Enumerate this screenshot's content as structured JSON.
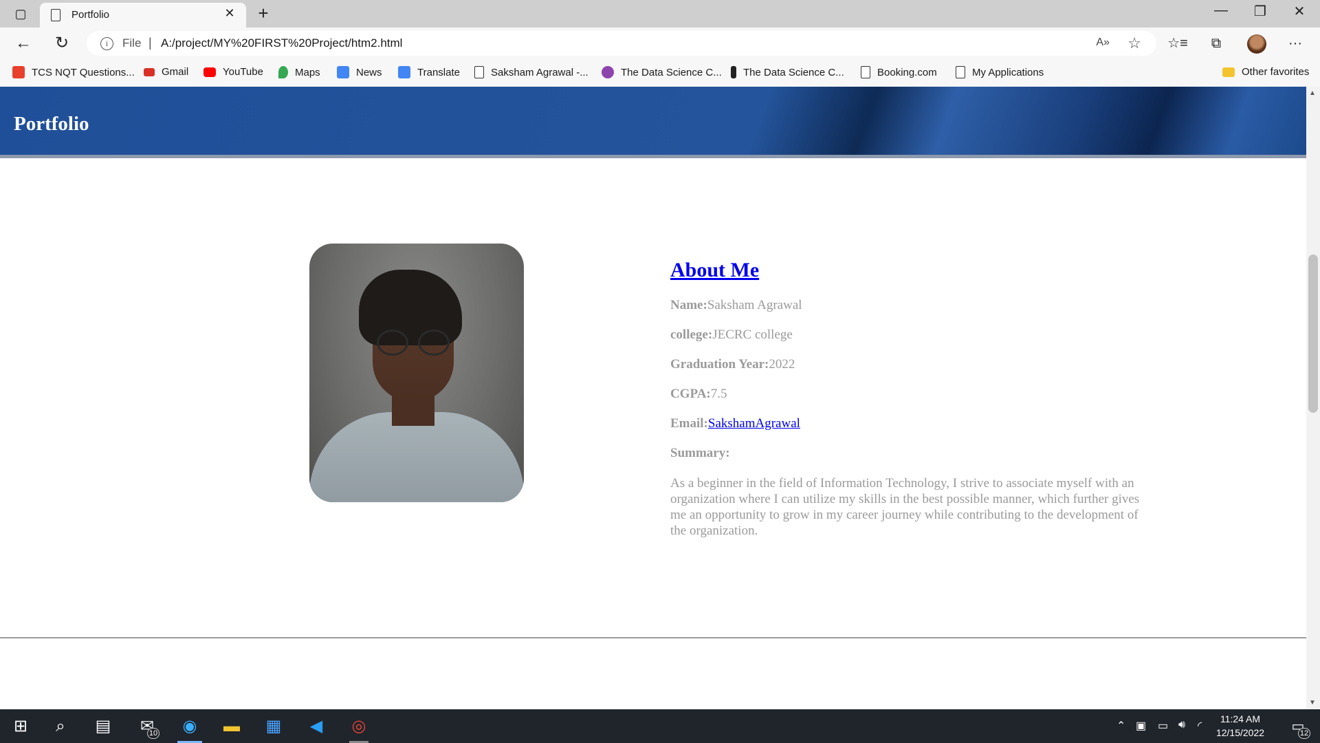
{
  "browser": {
    "tab_title": "Portfolio",
    "tab_close": "✕",
    "new_tab": "+",
    "window_minimize": "—",
    "window_restore": "❐",
    "window_close": "✕",
    "back": "←",
    "reload": "↻",
    "scheme": "File",
    "url": "A:/project/MY%20FIRST%20Project/htm2.html",
    "read_aloud": "A»",
    "add_favorite": "☆",
    "favorites": "☆≡",
    "collections": "⧉",
    "more": "···"
  },
  "bookmarks": [
    {
      "label": "TCS NQT Questions...",
      "icon": "tcs-icon",
      "color": "#e8402b"
    },
    {
      "label": "Gmail",
      "icon": "gmail-icon",
      "color": "#d93025"
    },
    {
      "label": "YouTube",
      "icon": "youtube-icon",
      "color": "#ff0000"
    },
    {
      "label": "Maps",
      "icon": "maps-icon",
      "color": "#34a853"
    },
    {
      "label": "News",
      "icon": "news-icon",
      "color": "#4285f4"
    },
    {
      "label": "Translate",
      "icon": "translate-icon",
      "color": "#4285f4"
    },
    {
      "label": "Saksham Agrawal -...",
      "icon": "page-icon",
      "color": "#ffffff"
    },
    {
      "label": "The Data Science C...",
      "icon": "datascience-icon",
      "color": "#8e44ad"
    },
    {
      "label": "The Data Science C...",
      "icon": "datascience-icon-2",
      "color": "#222222"
    },
    {
      "label": "Booking.com",
      "icon": "page-icon",
      "color": "#ffffff"
    },
    {
      "label": "My Applications",
      "icon": "page-icon",
      "color": "#ffffff"
    }
  ],
  "other_favorites": "Other favorites",
  "page": {
    "header_title": "Portfolio",
    "about_heading": "About Me",
    "fields": [
      {
        "label": "Name:",
        "value": "Saksham Agrawal"
      },
      {
        "label": "college:",
        "value": "JECRC college"
      },
      {
        "label": "Graduation Year:",
        "value": "2022"
      },
      {
        "label": "CGPA:",
        "value": "7.5"
      }
    ],
    "email_label": "Email:",
    "email_link": "SakshamAgrawal",
    "summary_label": "Summary:",
    "summary_text": "As a beginner in the field of Information Technology, I strive to associate myself with an organization where I can utilize my skills in the best possible manner, which further gives me an opportunity to grow in my career journey while contributing to the development of the organization."
  },
  "taskbar": {
    "mail_badge": "10",
    "notifications_badge": "12",
    "time": "11:24 AM",
    "date": "12/15/2022"
  },
  "colors": {
    "header_blue": "#1f4f98",
    "link_blue": "#0000ee",
    "text_grey": "#9a9a9a",
    "taskbar": "#20252c"
  }
}
